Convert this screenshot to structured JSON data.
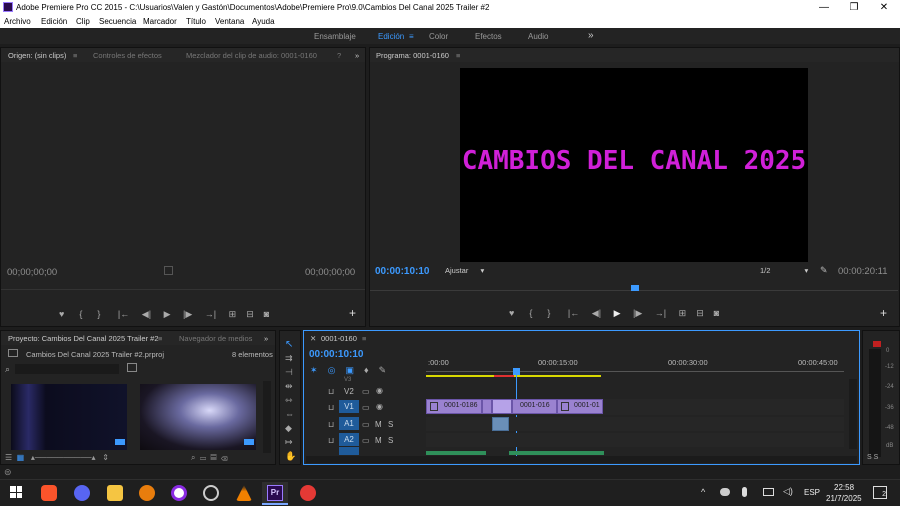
{
  "window": {
    "title": "Adobe Premiere Pro CC 2015 - C:\\Usuarios\\Valen y Gastón\\Documentos\\Adobe\\Premiere Pro\\9.0\\Cambios Del Canal 2025 Trailer #2",
    "minimize": "—",
    "maximize": "❐",
    "close": "✕"
  },
  "menu": [
    "Archivo",
    "Edición",
    "Clip",
    "Secuencia",
    "Marcador",
    "Título",
    "Ventana",
    "Ayuda"
  ],
  "workspaces": {
    "items": [
      "Ensamblaje",
      "Edición",
      "Color",
      "Efectos",
      "Audio"
    ],
    "active": "Edición",
    "more": "»"
  },
  "source_panel": {
    "tab_origin": "Origen: (sin clips)",
    "tab_effects": "Controles de efectos",
    "tab_mixer": "Mezclador del clip de audio: 0001-0160",
    "more": "?",
    "more2": "»",
    "timecode_left": "00;00;00;00",
    "timecode_right": "00;00;00;00"
  },
  "program_panel": {
    "tab": "Programa: 0001-0160",
    "video_text": "CAMBIOS DEL CANAL 2025",
    "timecode": "00:00:10:10",
    "fit": "Ajustar",
    "resolution": "1/2",
    "duration": "00:00:20:11"
  },
  "project_panel": {
    "tab_project": "Proyecto: Cambios Del Canal 2025 Trailer #2",
    "tab_media": "Navegador de medios",
    "more": "»",
    "file": "Cambios Del Canal 2025 Trailer #2.prproj",
    "count": "8 elementos"
  },
  "timeline": {
    "tab": "0001-0160",
    "timecode": "00:00:10:10",
    "ruler": [
      ":00:00",
      "00:00:15:00",
      "00:00:30:00",
      "00:00:45:00"
    ],
    "tracks": {
      "v3": "V3",
      "v2": "V2",
      "v1": "V1",
      "a1": "A1",
      "a2": "A2",
      "mute": "M",
      "solo": "S"
    },
    "clips": [
      "0001-0186",
      "0001-016",
      "0001-01"
    ]
  },
  "meter": {
    "ticks": [
      "0",
      "-12",
      "-24",
      "-36",
      "-48",
      "dB"
    ],
    "solo": "S S"
  },
  "taskbar": {
    "lang": "ESP",
    "time": "22:58",
    "date": "21/7/2025",
    "notifications": "2",
    "chevron": "^"
  },
  "icon_glyphs": {
    "home": "⌂",
    "play": "▶",
    "step_back": "◀|",
    "step_fwd": "|▶",
    "mark": "♥",
    "in": "{",
    "out": "}",
    "plus": "+",
    "camera": "◉",
    "wrench": "🔧"
  },
  "colors": {
    "accent": "#3c9aff",
    "title_text": "#d020d8",
    "clip_video": "#9a82d0",
    "clip_audio": "#2f8f5a",
    "premiere": "#2a0a50"
  }
}
